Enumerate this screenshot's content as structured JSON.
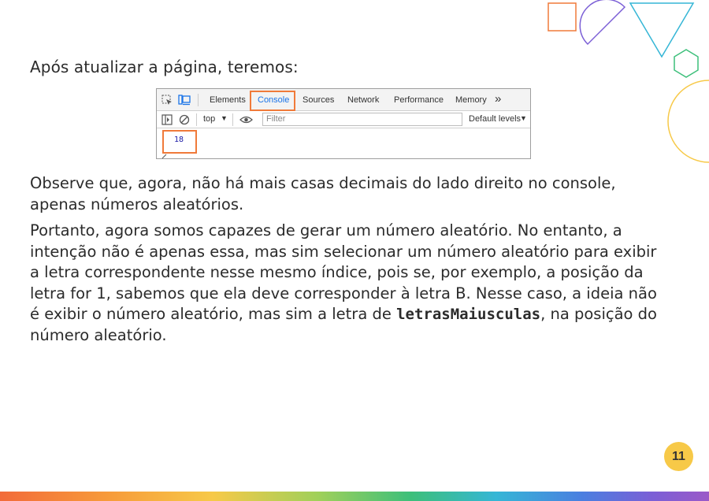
{
  "slide": {
    "intro": "Após atualizar a página, teremos:",
    "paragraph1": "Observe que, agora, não há mais casas decimais do lado direito no console, apenas números aleatórios.",
    "paragraph2_before": "Portanto, agora somos capazes de gerar um número aleatório. No entanto, a intenção não é apenas essa, mas sim selecionar um número aleatório para exibir a letra correspondente nesse mesmo índice, pois se, por exemplo, a posição da letra for 1, sabemos que ela deve corresponder à letra B. Nesse caso, a ideia não é exibir o número aleatório, mas sim a letra de ",
    "paragraph2_code": "letrasMaiusculas",
    "paragraph2_after": ", na posição do número aleatório.",
    "page_number": "11"
  },
  "devtools": {
    "tabs": [
      "Elements",
      "Console",
      "Sources",
      "Network",
      "Performance",
      "Memory"
    ],
    "active_tab": "Console",
    "more_tabs_glyph": "»",
    "context": "top",
    "filter_placeholder": "Filter",
    "levels": "Default levels",
    "console_output": "18"
  },
  "colors": {
    "highlight": "#f07a3a",
    "badge": "#f7c948",
    "link_blue": "#1a73e8"
  }
}
